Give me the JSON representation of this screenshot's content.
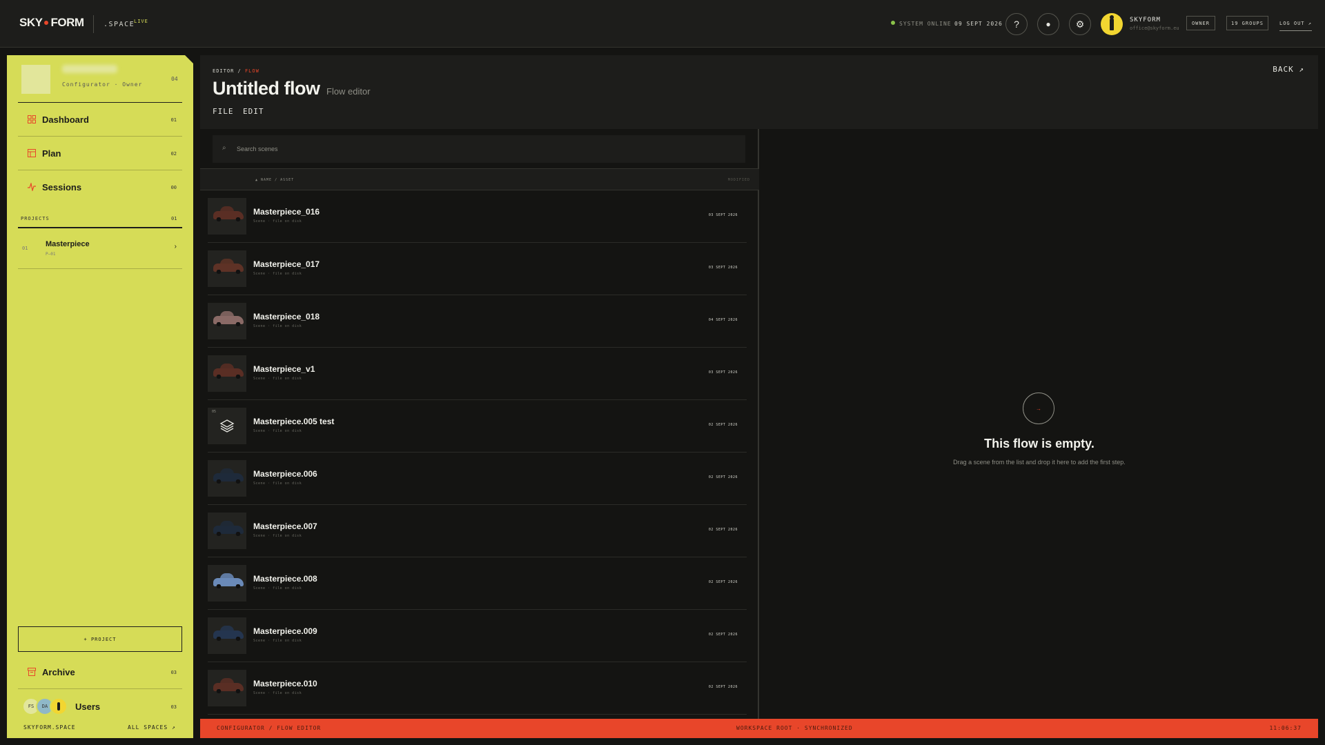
{
  "topbar": {
    "logo_left": "SKY",
    "logo_right": "FORM",
    "space": ".SPACE",
    "live": "LIVE",
    "status": "SYSTEM ONLINE",
    "date": "09 SEPT 2026",
    "help_glyph": "?",
    "record_glyph": "●",
    "settings_glyph": "⚙",
    "user_name": "SKYFORM",
    "user_email": "office@skyform.eu",
    "role": "OWNER",
    "groups": "19 GROUPS",
    "logout": "LOG OUT ↗"
  },
  "sidebar": {
    "role_line": "Configurator · Owner",
    "count": "04",
    "nav": [
      {
        "label": "Dashboard",
        "num": "01",
        "icon": "dashboard-icon"
      },
      {
        "label": "Plan",
        "num": "02",
        "icon": "plan-icon"
      },
      {
        "label": "Sessions",
        "num": "00",
        "icon": "pulse-icon"
      }
    ],
    "projects_label": "PROJECTS",
    "projects_count": "01",
    "project": {
      "index": "01",
      "name": "Masterpiece",
      "code": "P—01",
      "arrow": "›"
    },
    "add_project": "+ PROJECT",
    "archive": {
      "label": "Archive",
      "num": "03"
    },
    "users": {
      "label": "Users",
      "num": "03",
      "avatars": [
        "FS",
        "DA"
      ]
    },
    "footer_left": "SKYFORM.SPACE",
    "footer_right": "ALL SPACES ↗"
  },
  "header": {
    "crumb_root": "EDITOR /",
    "crumb_current": "FLOW",
    "title": "Untitled flow",
    "subtitle": "Flow editor",
    "menu": [
      "FILE",
      "EDIT"
    ],
    "back": "BACK ↗"
  },
  "list": {
    "search_placeholder": "Search scenes",
    "col_name": "▲ NAME / ASSET",
    "col_modified": "MODIFIED",
    "rows": [
      {
        "name": "Masterpiece_016",
        "meta": "Scene · file on disk",
        "date": "03 SEPT 2026",
        "car": "#5a2e24"
      },
      {
        "name": "Masterpiece_017",
        "meta": "Scene · file on disk",
        "date": "03 SEPT 2026",
        "car": "#5e3226"
      },
      {
        "name": "Masterpiece_018",
        "meta": "Scene · file on disk",
        "date": "04 SEPT 2026",
        "car": "#8a6a66"
      },
      {
        "name": "Masterpiece_v1",
        "meta": "Scene · file on disk",
        "date": "03 SEPT 2026",
        "car": "#5a2e24"
      },
      {
        "name": "Masterpiece.005 test",
        "meta": "Scene · file on disk",
        "date": "02 SEPT 2026",
        "car": "",
        "tag": "05"
      },
      {
        "name": "Masterpiece.006",
        "meta": "Scene · file on disk",
        "date": "02 SEPT 2026",
        "car": "#1e2a3a"
      },
      {
        "name": "Masterpiece.007",
        "meta": "Scene · file on disk",
        "date": "02 SEPT 2026",
        "car": "#1e2a3a"
      },
      {
        "name": "Masterpiece.008",
        "meta": "Scene · file on disk",
        "date": "02 SEPT 2026",
        "car": "#6a8ab8"
      },
      {
        "name": "Masterpiece.009",
        "meta": "Scene · file on disk",
        "date": "02 SEPT 2026",
        "car": "#24354f"
      },
      {
        "name": "Masterpiece.010",
        "meta": "Scene · file on disk",
        "date": "02 SEPT 2026",
        "car": "#5a2e24"
      }
    ]
  },
  "flow": {
    "empty_glyph": "→",
    "empty_title": "This flow is empty.",
    "empty_sub": "Drag a scene from the list and drop it here to add the first step."
  },
  "footer": {
    "left": "CONFIGURATOR / FLOW EDITOR",
    "center": "WORKSPACE ROOT · SYNCHRONIZED",
    "right": "11:06:37"
  }
}
